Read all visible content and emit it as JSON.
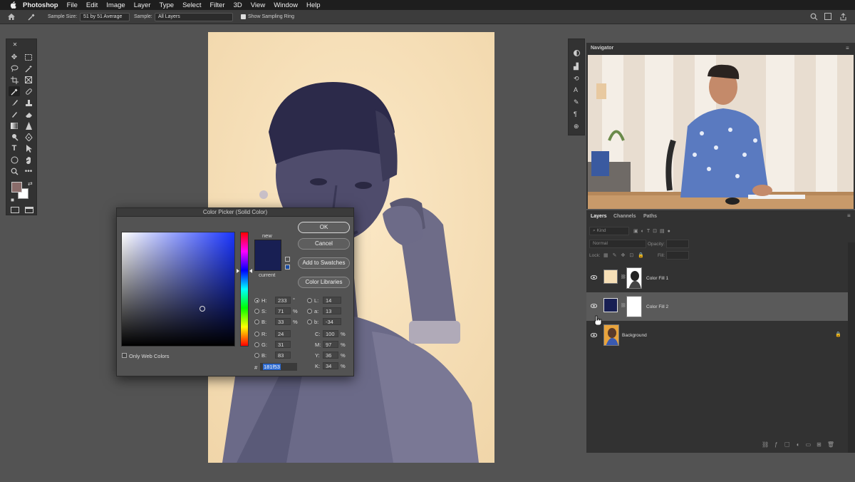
{
  "menubar": {
    "app": "Photoshop",
    "items": [
      "File",
      "Edit",
      "Image",
      "Layer",
      "Type",
      "Select",
      "Filter",
      "3D",
      "View",
      "Window",
      "Help"
    ]
  },
  "options": {
    "sample_size_label": "Sample Size:",
    "sample_size_value": "51 by 51 Average",
    "sample_label": "Sample:",
    "sample_value": "All Layers",
    "show_ring_label": "Show Sampling Ring"
  },
  "picker": {
    "title": "Color Picker (Solid Color)",
    "ok": "OK",
    "cancel": "Cancel",
    "add_swatches": "Add to Swatches",
    "color_libraries": "Color Libraries",
    "new_label": "new",
    "current_label": "current",
    "only_web": "Only Web Colors",
    "new_color": "#181f53",
    "current_color": "#181f53",
    "H": "233",
    "S": "71",
    "B": "33",
    "R": "24",
    "G": "31",
    "Bv": "83",
    "L": "14",
    "a": "13",
    "b": "-34",
    "C": "100",
    "M": "97",
    "Y": "36",
    "K": "34",
    "hex": "181f53",
    "deg": "°",
    "pct": "%",
    "hash": "#"
  },
  "panels": {
    "navigator": "Navigator",
    "layers_tab": "Layers",
    "channels_tab": "Channels",
    "paths_tab": "Paths",
    "kind": "Kind",
    "blend": "Normal",
    "opacity": "Opacity:",
    "lock": "Lock:",
    "fill": "Fill:",
    "layers": [
      {
        "name": "Color Fill 1",
        "swatch": "#f6dfb6",
        "selected": false
      },
      {
        "name": "Color Fill 2",
        "swatch": "#181f53",
        "selected": true
      },
      {
        "name": "Background",
        "swatch": "#e8a33c",
        "selected": false
      }
    ]
  }
}
